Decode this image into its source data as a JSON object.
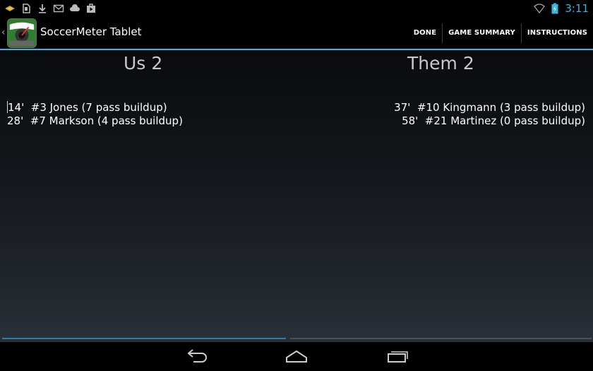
{
  "status_bar": {
    "notification_icons": [
      "store-icon",
      "sim-card-icon",
      "download-icon",
      "mail-icon",
      "cloud-upload-icon",
      "media-icon"
    ],
    "wifi_icon": "wifi-icon",
    "battery_icon": "battery-charging-icon",
    "time": "3:11",
    "accent_color": "#33b5e5"
  },
  "action_bar": {
    "title": "SoccerMeter Tablet",
    "actions": [
      {
        "label": "DONE"
      },
      {
        "label": "GAME SUMMARY"
      },
      {
        "label": "INSTRUCTIONS"
      }
    ]
  },
  "teams": {
    "us": {
      "name": "Us",
      "score": "2",
      "goals": [
        "14'  #3 Jones (7 pass buildup)",
        "28'  #7 Markson (4 pass buildup)"
      ]
    },
    "them": {
      "name": "Them",
      "score": "2",
      "goals": [
        "37'  #10 Kingmann (3 pass buildup)",
        "58'  #21 Martinez (0 pass buildup)"
      ]
    }
  },
  "nav_bar": {
    "buttons": [
      "back-icon",
      "home-icon",
      "recent-apps-icon"
    ]
  }
}
